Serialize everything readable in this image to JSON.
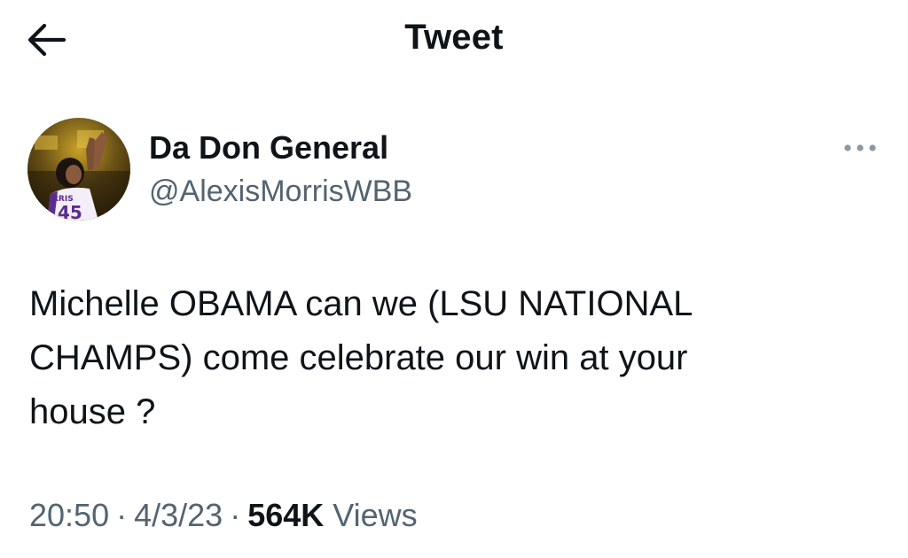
{
  "header": {
    "title": "Tweet",
    "back_icon": "arrow-left-icon"
  },
  "tweet": {
    "author": {
      "display_name": "Da Don General",
      "handle": "@AlexisMorrisWBB",
      "avatar_jersey_name": "RRIS",
      "avatar_jersey_number": "45"
    },
    "more_icon": "more-horizontal-icon",
    "text_lines": [
      "Michelle OBAMA can we (LSU NATIONAL",
      "CHAMPS) come celebrate our win at your",
      "house ?"
    ],
    "time": "20:50",
    "separator": "·",
    "date": "4/3/23",
    "views_count": "564K",
    "views_label": "Views"
  },
  "colors": {
    "text_primary": "#0f1419",
    "text_secondary": "#536471",
    "jersey_purple": "#5b2d8e",
    "arena_gold": "#c9a227"
  }
}
